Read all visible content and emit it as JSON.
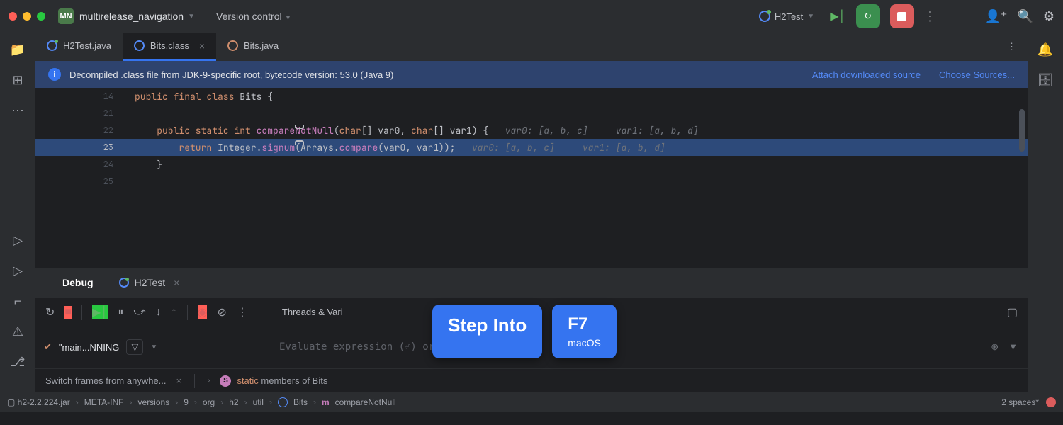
{
  "titlebar": {
    "project_badge": "MN",
    "project_name": "multirelease_navigation",
    "vc_label": "Version control",
    "run_config": "H2Test"
  },
  "tabs": [
    {
      "label": "H2Test.java",
      "active": false,
      "running": true
    },
    {
      "label": "Bits.class",
      "active": true
    },
    {
      "label": "Bits.java",
      "active": false
    }
  ],
  "banner": {
    "message": "Decompiled .class file from JDK-9-specific root, bytecode version: 53.0 (Java 9)",
    "link1": "Attach downloaded source",
    "link2": "Choose Sources..."
  },
  "editor": {
    "lines": [
      {
        "n": "14",
        "html": "<span class='kw'>public final class</span> <span class='cls'>Bits</span> {"
      },
      {
        "n": "21",
        "html": ""
      },
      {
        "n": "22",
        "html": "    <span class='kw'>public static int</span> <span class='method'>compareNotNull</span>(<span class='kw'>char</span>[] var0, <span class='kw'>char</span>[] var1) {   <span class='hint'>var0: [a, b, c]     var1: [a, b, d]</span>"
      },
      {
        "n": "23",
        "html": "        <span class='kw'>return</span> Integer.<span class='method'>signum</span>(Arrays.<span class='method'>compare</span>(var0, var1));   <span class='hint'>var0: [a, b, c]     var1: [a, b, d]</span>",
        "exec": true
      },
      {
        "n": "24",
        "html": "    }"
      },
      {
        "n": "25",
        "html": ""
      }
    ]
  },
  "debug": {
    "tab_main": "Debug",
    "tab_session": "H2Test",
    "threads_label": "Threads & Vari",
    "frame_text": "\"main...NNING",
    "eval_placeholder": "Evaluate expression (⏎) or",
    "switch_text": "Switch frames from anywhe...",
    "static_text": "static members of Bits"
  },
  "overlay": {
    "action": "Step Into",
    "key": "F7",
    "os": "macOS"
  },
  "breadcrumbs": [
    "h2-2.2.224.jar",
    "META-INF",
    "versions",
    "9",
    "org",
    "h2",
    "util",
    "Bits",
    "compareNotNull"
  ],
  "status": {
    "indent": "2 spaces*"
  }
}
